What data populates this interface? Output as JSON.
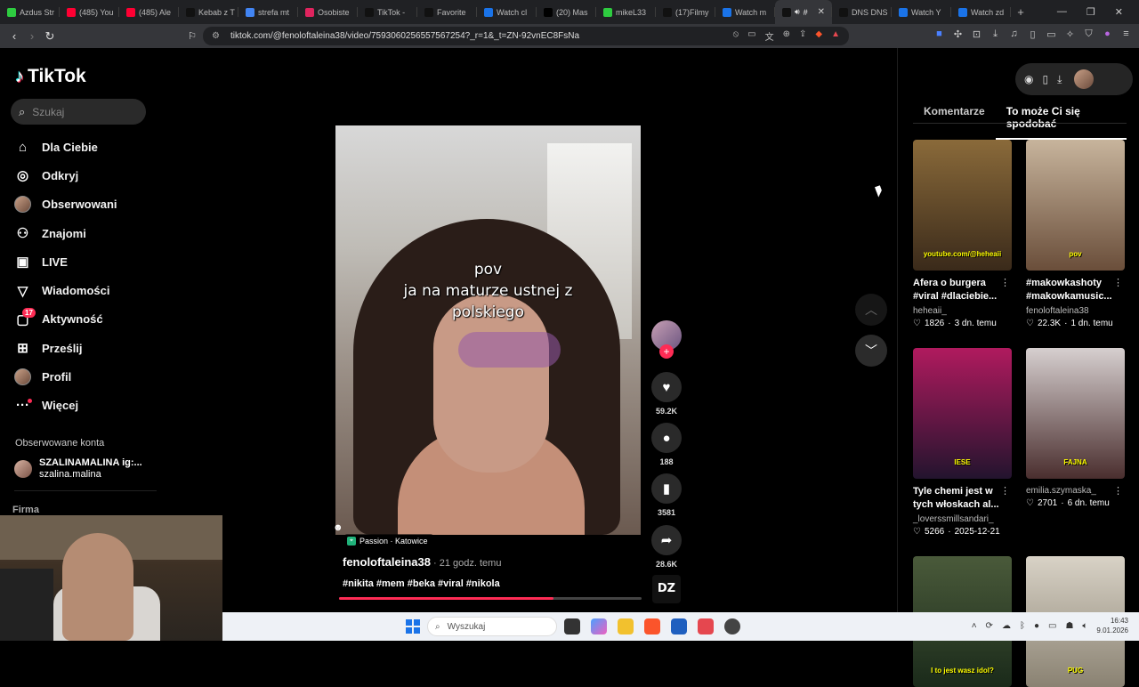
{
  "browser": {
    "tabs": [
      {
        "label": "Azdus Str",
        "color": "#2ecc40"
      },
      {
        "label": "(485) You",
        "color": "#ff0033"
      },
      {
        "label": "(485) Ale",
        "color": "#ff0033"
      },
      {
        "label": "Kebab z T",
        "color": "#111111"
      },
      {
        "label": "strefa mt",
        "color": "#4285f4"
      },
      {
        "label": "Osobiste",
        "color": "#e0245e"
      },
      {
        "label": "TikTok - ",
        "color": "#111111"
      },
      {
        "label": "Favorite",
        "color": "#111111"
      },
      {
        "label": "Watch cl",
        "color": "#1a73e8"
      },
      {
        "label": "(20) Mas",
        "color": "#000000"
      },
      {
        "label": "mikeL33",
        "color": "#2ecc40"
      },
      {
        "label": "(17)Filmy",
        "color": "#111111"
      },
      {
        "label": "Watch m",
        "color": "#1a73e8"
      },
      {
        "label": "#",
        "color": "#111111"
      },
      {
        "label": "DNS DNS",
        "color": "#111111"
      },
      {
        "label": "Watch Y",
        "color": "#1a73e8"
      },
      {
        "label": "Watch zd",
        "color": "#1a73e8"
      }
    ],
    "active_tab_index": 13,
    "url": "tiktok.com/@fenoloftaleina38/video/7593060256557567254?_r=1&_t=ZN-92vnEC8FsNa"
  },
  "sidebar": {
    "logo": "TikTok",
    "search_placeholder": "Szukaj",
    "nav": [
      {
        "label": "Dla Ciebie",
        "icon": "home-icon",
        "glyph": "⌂"
      },
      {
        "label": "Odkryj",
        "icon": "compass-icon",
        "glyph": "◎"
      },
      {
        "label": "Obserwowani",
        "icon": "avatar",
        "glyph": ""
      },
      {
        "label": "Znajomi",
        "icon": "friends-icon",
        "glyph": "⚇"
      },
      {
        "label": "LIVE",
        "icon": "live-icon",
        "glyph": "▣"
      },
      {
        "label": "Wiadomości",
        "icon": "messages-icon",
        "glyph": "▽"
      },
      {
        "label": "Aktywność",
        "icon": "activity-icon",
        "glyph": "▢",
        "badge": "17"
      },
      {
        "label": "Prześlij",
        "icon": "upload-icon",
        "glyph": "⊞"
      },
      {
        "label": "Profil",
        "icon": "avatar",
        "glyph": ""
      },
      {
        "label": "Więcej",
        "icon": "more-icon",
        "glyph": "···"
      }
    ],
    "followed_title": "Obserwowane konta",
    "followed": {
      "name": "SZALINAMALINA ig:...",
      "handle": "szalina.malina"
    },
    "firma": "Firma"
  },
  "video": {
    "caption_lines": [
      "pov",
      "ja na maturze ustnej z",
      "polskiego"
    ],
    "location": "Passion · Katowice",
    "author": "fenoloftaleina38",
    "time": " · 21 godz. temu",
    "tags": "#nikita #mem #beka #viral #nikola",
    "progress": 0.71,
    "likes": "59.2K",
    "comments": "188",
    "saves": "3581",
    "shares": "28.6K",
    "music_label": "DZ"
  },
  "right_panel": {
    "tabs": [
      "Komentarze",
      "To może Ci się spodobać"
    ],
    "active_tab": 1,
    "cards": [
      {
        "title": "Afera o burgera #viral #dlaciebie...",
        "author": "heheaii_",
        "likes": "1826",
        "when": "3 dn. temu",
        "thumb_label": "youtube.com/@heheaii",
        "c1": "#8a6a3a",
        "c2": "#3a2a1a"
      },
      {
        "title": "#makowkashoty #makowkamusic...",
        "author": "fenoloftaleina38",
        "likes": "22.3K",
        "when": "1 dn. temu",
        "thumb_label": "pov",
        "c1": "#c7b49c",
        "c2": "#6a4e3a"
      },
      {
        "title": "Tyle chemi jest w tych włoskach al...",
        "author": "_loverssmillsandari_",
        "likes": "5266",
        "when": "2025-12-21",
        "thumb_label": "IESE",
        "c1": "#b01a5e",
        "c2": "#23142e"
      },
      {
        "title": "",
        "author": "emilia.szymaska_",
        "likes": "2701",
        "when": "6 dn. temu",
        "thumb_label": "FAJNA",
        "c1": "#d6cfcf",
        "c2": "#4a2e2e"
      },
      {
        "title": "",
        "author": "",
        "likes": "",
        "when": "",
        "thumb_label": "I to jest wasz idol?",
        "c1": "#4a5a3a",
        "c2": "#1a2a1a"
      },
      {
        "title": "",
        "author": "",
        "likes": "",
        "when": "",
        "thumb_label": "PUG",
        "c1": "#d8d2c6",
        "c2": "#8a8272"
      }
    ]
  },
  "taskbar": {
    "search_placeholder": "Wyszukaj",
    "time": "16:43",
    "date": "9.01.2026"
  }
}
